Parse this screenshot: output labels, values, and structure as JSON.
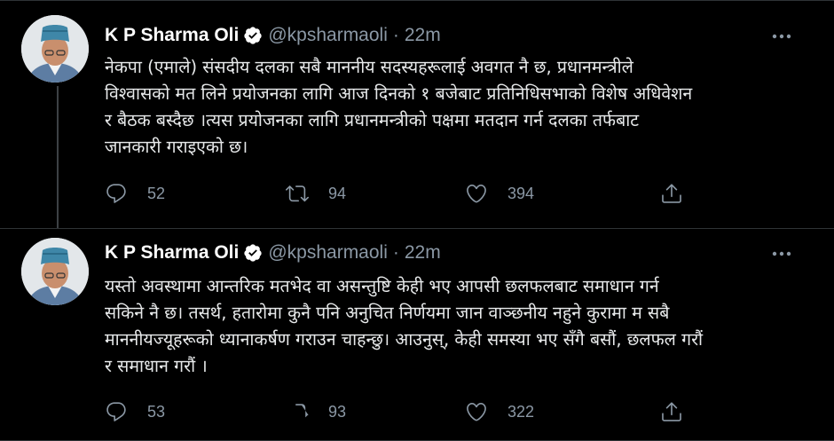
{
  "tweets": [
    {
      "author": "K P Sharma Oli",
      "handle": "@kpsharmaoli",
      "separator": "·",
      "time": "22m",
      "text": "नेकपा (एमाले) संसदीय दलका सबै माननीय सदस्यहरूलाई अवगत नै छ, प्रधानमन्त्रीले\nविश्वासको मत लिने प्रयोजनका लागि आज दिनको १ बजेबाट प्रतिनिधिसभाको विशेष अधिवेशन\nर बैठक बस्दैछ ।त्यस प्रयोजनका लागि प्रधानमन्त्रीको पक्षमा मतदान गर्न दलका तर्फबाट\nजानकारी गराइएको छ।",
      "replies": "52",
      "retweets": "94",
      "likes": "394"
    },
    {
      "author": "K P Sharma Oli",
      "handle": "@kpsharmaoli",
      "separator": "·",
      "time": "22m",
      "text": "यस्तो अवस्थामा आन्तरिक मतभेद वा असन्तुष्टि केही भए आपसी छलफलबाट समाधान गर्न\nसकिने नै छ। तसर्थ, हतारोमा कुनै पनि अनुचित निर्णयमा जान वाञ्छनीय नहुने कुरामा म सबै\nमाननीयज्यूहरूको ध्यानाकर्षण गराउन चाहन्छु। आउनुस्, केही समस्या भए सँगै बसौं, छलफल गरौं\nर समाधान गरौं ।",
      "replies": "53",
      "retweets": "93",
      "likes": "322"
    }
  ],
  "icons": {
    "verified": "verified-badge-icon",
    "more": "more-options-icon",
    "reply": "reply-icon",
    "retweet": "retweet-icon",
    "like": "like-icon",
    "share": "share-icon"
  },
  "colors": {
    "background": "#000000",
    "text": "#e7e9ea",
    "secondary": "#8b98a5",
    "divider": "#2f3336",
    "verified": "#ffffff"
  }
}
